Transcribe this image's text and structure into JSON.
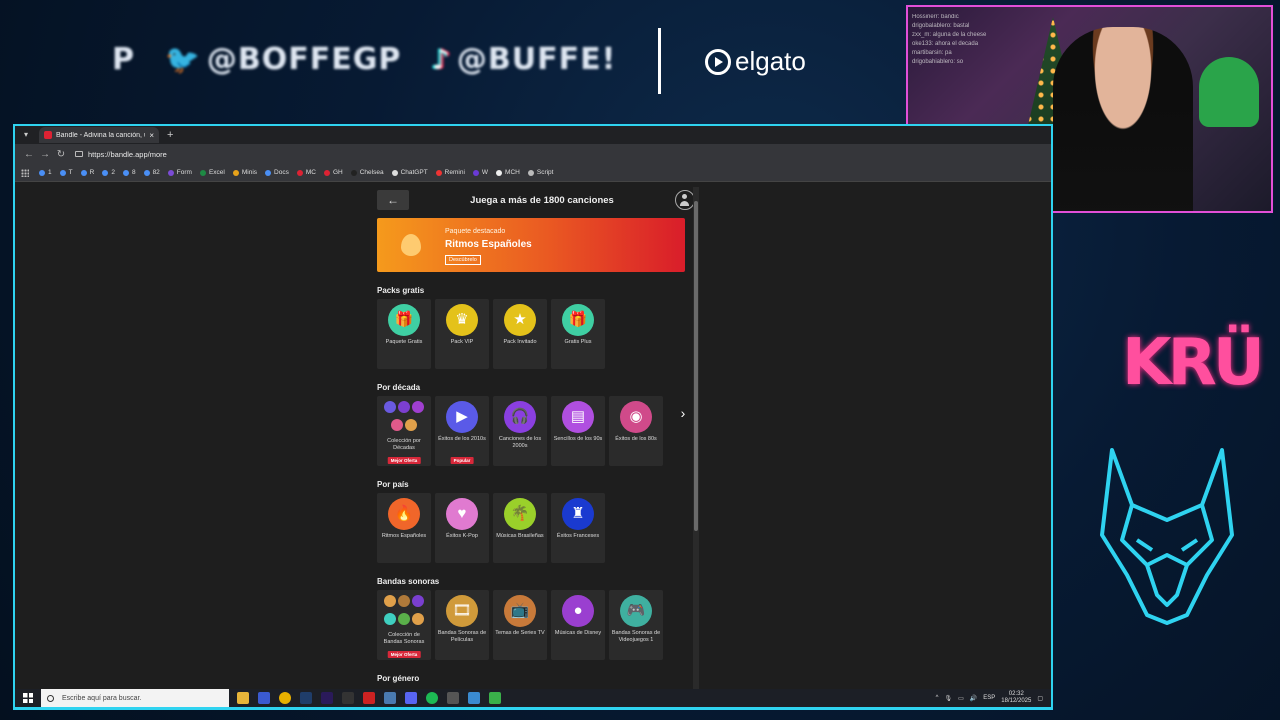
{
  "overlay": {
    "p_text": "P",
    "twitter_handle": "@BOFFEGP",
    "tiktok_handle": "@BUFFE!",
    "sponsor": "elgato",
    "team_logo_text": "KRÜ"
  },
  "webcam": {
    "chat_lines": [
      "Hossinerr: bandic",
      "drigobalablero: bastal",
      "zxx_m: alguna de la cheese",
      "oke133: ahora el decada",
      "martibarsin: pa",
      "drigobahiablero: so"
    ]
  },
  "browser": {
    "tab_title": "Bandle - Adivina la canción, un",
    "new_tab": "+",
    "url": "https://bandle.app/more",
    "bookmarks": [
      {
        "label": "1",
        "color": "#4a8ff5"
      },
      {
        "label": "T",
        "color": "#4a8ff5"
      },
      {
        "label": "R",
        "color": "#4a8ff5"
      },
      {
        "label": "2",
        "color": "#4a8ff5"
      },
      {
        "label": "8",
        "color": "#4a8ff5"
      },
      {
        "label": "82",
        "color": "#4a8ff5"
      },
      {
        "label": "Form",
        "color": "#7b4bd6"
      },
      {
        "label": "Excel",
        "color": "#1e8a44"
      },
      {
        "label": "Minis",
        "color": "#e7a21a"
      },
      {
        "label": "Docs",
        "color": "#4a8ff5"
      },
      {
        "label": "MC",
        "color": "#d23"
      },
      {
        "label": "GH",
        "color": "#d23"
      },
      {
        "label": "Chelsea",
        "color": "#222"
      },
      {
        "label": "ChatGPT",
        "color": "#ddd"
      },
      {
        "label": "Remini",
        "color": "#e33"
      },
      {
        "label": "W",
        "color": "#6a3ad6"
      },
      {
        "label": "MCH",
        "color": "#eee"
      },
      {
        "label": "Script",
        "color": "#bbb"
      }
    ]
  },
  "app": {
    "header_title": "Juega a más de 1800 canciones",
    "back_label": "←",
    "banner": {
      "kicker": "Paquete destacado",
      "title": "Ritmos Españoles",
      "cta": "Descúbrelo"
    },
    "sections": {
      "free": {
        "title": "Packs gratis",
        "cards": [
          {
            "label": "Paquete Gratis",
            "color": "#3fcfa3",
            "glyph": "🎁"
          },
          {
            "label": "Pack VIP",
            "color": "#e4c21a",
            "glyph": "♛"
          },
          {
            "label": "Pack Invitado",
            "color": "#e4c21a",
            "glyph": "★"
          },
          {
            "label": "Gratis Plus",
            "color": "#3fcfa3",
            "glyph": "🎁"
          }
        ]
      },
      "decade": {
        "title": "Por década",
        "cards": [
          {
            "label": "Colección por Décadas",
            "badge": "Mejor Oferta",
            "multi": [
              "#6a5ae0",
              "#7c3fd0",
              "#a03fd0",
              "#e05a8a",
              "#e0a04a"
            ]
          },
          {
            "label": "Éxitos de los 2010s",
            "badge": "Popular",
            "color": "#5a5ae8",
            "glyph": "▶"
          },
          {
            "label": "Canciones de los 2000s",
            "color": "#8a3fe0",
            "glyph": "🎧"
          },
          {
            "label": "Sencillos de los 90s",
            "color": "#b04fe0",
            "glyph": "▤"
          },
          {
            "label": "Éxitos de los 80s",
            "color": "#d04a8a",
            "glyph": "◉"
          }
        ],
        "next": "›"
      },
      "country": {
        "title": "Por país",
        "cards": [
          {
            "label": "Ritmos Españoles",
            "color": "#f0662a",
            "glyph": "🔥"
          },
          {
            "label": "Éxitos K-Pop",
            "color": "#e07ad0",
            "glyph": "♥"
          },
          {
            "label": "Músicas Brasileñas",
            "color": "#9ad02a",
            "glyph": "🌴"
          },
          {
            "label": "Éxitos Franceses",
            "color": "#1a3ad0",
            "glyph": "♜"
          }
        ]
      },
      "soundtracks": {
        "title": "Bandas sonoras",
        "cards": [
          {
            "label": "Colección de Bandas Sonoras",
            "badge": "Mejor Oferta",
            "multi": [
              "#e0a04a",
              "#b07a3a",
              "#7a3fd0",
              "#3fcfc0",
              "#5ab04a",
              "#e0a04a"
            ]
          },
          {
            "label": "Bandas Sonoras de Películas",
            "color": "#d09a3a",
            "glyph": "🎞"
          },
          {
            "label": "Temas de Series TV",
            "color": "#c87a3a",
            "glyph": "📺"
          },
          {
            "label": "Músicas de Disney",
            "color": "#9a3fd0",
            "glyph": "●"
          },
          {
            "label": "Bandas Sonoras de Videojuegos 1",
            "color": "#3fb0a0",
            "glyph": "🎮"
          }
        ]
      },
      "genre": {
        "title": "Por género"
      }
    }
  },
  "taskbar": {
    "search_placeholder": "Escribe aquí para buscar.",
    "lang": "ESP",
    "time": "02:32",
    "date": "18/12/2025"
  }
}
